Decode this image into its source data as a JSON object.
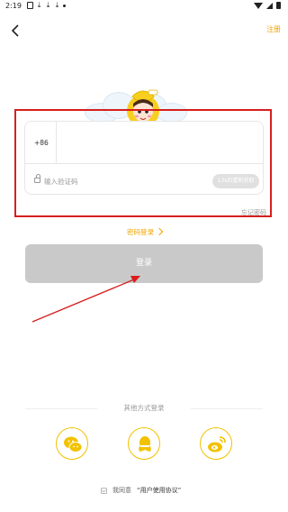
{
  "status_bar": {
    "time": "2:19"
  },
  "header": {
    "register_label": "注册"
  },
  "form": {
    "country_code": "+86",
    "phone_value": "",
    "code_placeholder": "输入验证码",
    "resend_label": "13s后重新获取"
  },
  "links": {
    "forgot": "忘记密码",
    "password_login": "密码登录"
  },
  "login_button_label": "登录",
  "other_login": {
    "label": "其他方式登录",
    "methods": [
      "wechat",
      "qq",
      "weibo"
    ]
  },
  "agreement": {
    "prefix": "我同意",
    "link": "“用户使用协议”"
  },
  "colors": {
    "accent": "#f0a500",
    "highlight": "#d71e1e",
    "button_disabled": "#c9c9c9"
  },
  "icons": {
    "back": "chevron-left-icon",
    "lock": "lock-icon",
    "wechat": "wechat-icon",
    "qq": "qq-icon",
    "weibo": "weibo-icon"
  }
}
